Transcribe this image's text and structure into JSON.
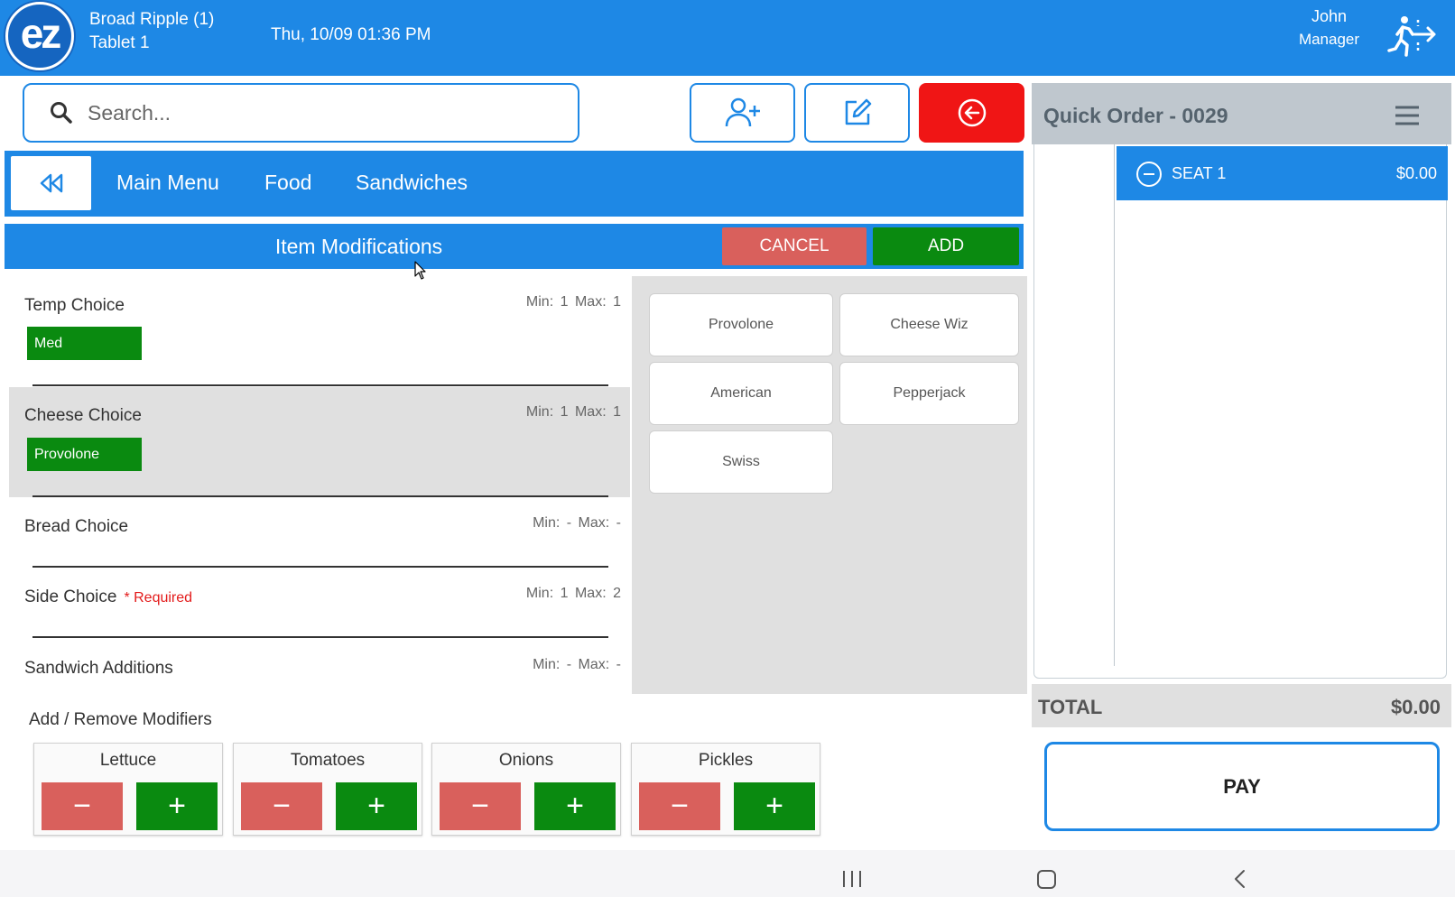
{
  "header": {
    "logo_text": "ez",
    "location": "Broad Ripple (1)",
    "device": "Tablet 1",
    "datetime": "Thu, 10/09 01:36 PM",
    "user_name": "John",
    "user_role": "Manager",
    "exit_icon": "running-exit-icon"
  },
  "search": {
    "placeholder": "Search...",
    "icon": "search-icon"
  },
  "toolbar": {
    "add_customer_icon": "user-plus-icon",
    "edit_icon": "edit-icon",
    "back_icon": "arrow-left-circle-icon"
  },
  "breadcrumb": {
    "back_icon": "rewind-icon",
    "items": [
      "Main Menu",
      "Food",
      "Sandwiches"
    ]
  },
  "modifications": {
    "title": "Item Modifications",
    "cancel_label": "CANCEL",
    "add_label": "ADD",
    "groups": [
      {
        "name": "Temp Choice",
        "min_label": "Min:",
        "min": "1",
        "max_label": "Max:",
        "max": "1",
        "selected": "Med"
      },
      {
        "name": "Cheese Choice",
        "min_label": "Min:",
        "min": "1",
        "max_label": "Max:",
        "max": "1",
        "selected": "Provolone"
      },
      {
        "name": "Bread Choice",
        "min_label": "Min:",
        "min": "-",
        "max_label": "Max:",
        "max": "-"
      },
      {
        "name": "Side Choice",
        "required_text": "* Required",
        "min_label": "Min:",
        "min": "1",
        "max_label": "Max:",
        "max": "2"
      },
      {
        "name": "Sandwich Additions",
        "min_label": "Min:",
        "min": "-",
        "max_label": "Max:",
        "max": "-"
      }
    ],
    "options": [
      "Provolone",
      "Cheese Wiz",
      "American",
      "Pepperjack",
      "Swiss"
    ]
  },
  "add_remove": {
    "title": "Add / Remove Modifiers",
    "minus_symbol": "−",
    "plus_symbol": "+",
    "items": [
      "Lettuce",
      "Tomatoes",
      "Onions",
      "Pickles"
    ]
  },
  "order": {
    "title": "Quick Order - 0029",
    "menu_icon": "hamburger-icon",
    "seat_label": "SEAT 1",
    "seat_amount": "$0.00",
    "total_label": "TOTAL",
    "total_amount": "$0.00",
    "pay_label": "PAY"
  },
  "colors": {
    "primary_blue": "#1e88e5",
    "add_green": "#0a8a10",
    "cancel_red": "#d9605c",
    "danger_red": "#f01515"
  }
}
